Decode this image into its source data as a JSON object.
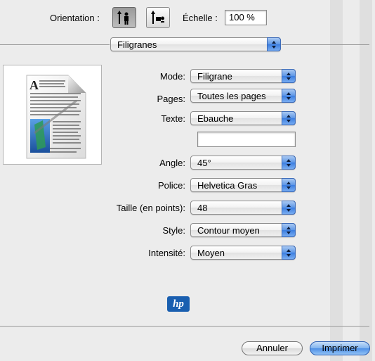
{
  "header": {
    "orientation_label": "Orientation :",
    "scale_label": "Échelle :",
    "scale_value": "100 %"
  },
  "section_popup": {
    "value": "Filigranes"
  },
  "form": {
    "mode": {
      "label": "Mode:",
      "value": "Filigrane"
    },
    "pages": {
      "label": "Pages:",
      "value": "Toutes les pages"
    },
    "text": {
      "label": "Texte:",
      "value": "Ebauche",
      "custom_text": ""
    },
    "angle": {
      "label": "Angle:",
      "value": "45°"
    },
    "font": {
      "label": "Police:",
      "value": "Helvetica Gras"
    },
    "size": {
      "label": "Taille (en points):",
      "value": "48"
    },
    "style": {
      "label": "Style:",
      "value": "Contour moyen"
    },
    "intensity": {
      "label": "Intensité:",
      "value": "Moyen"
    }
  },
  "brand": {
    "logo_text": "hp"
  },
  "footer": {
    "cancel_label": "Annuler",
    "print_label": "Imprimer"
  },
  "colors": {
    "accent": "#4d8fe6",
    "logo": "#1a5fb0"
  }
}
